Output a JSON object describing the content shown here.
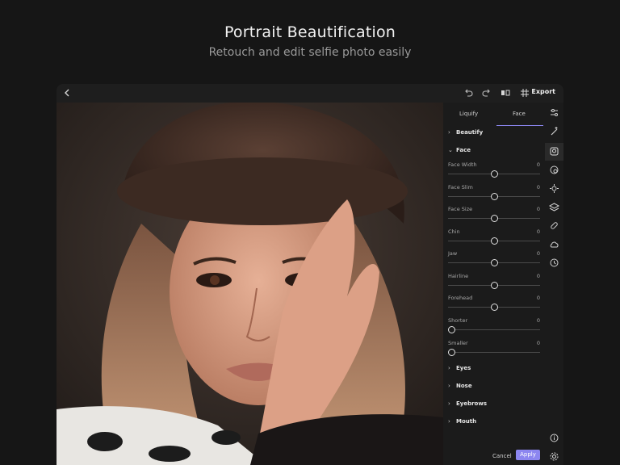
{
  "hero": {
    "title": "Portrait Beautification",
    "subtitle": "Retouch and edit selfie photo easily"
  },
  "toolbar": {
    "back_icon": "chevron-left-icon",
    "undo_icon": "undo-icon",
    "redo_icon": "redo-icon",
    "compare_icon": "compare-icon",
    "grid_icon": "grid-icon",
    "export_label": "Export"
  },
  "tabs": [
    {
      "label": "Liquify",
      "active": false
    },
    {
      "label": "Face",
      "active": true
    }
  ],
  "sections": {
    "beautify": "Beautify",
    "face": "Face",
    "eyes": "Eyes",
    "nose": "Nose",
    "eyebrows": "Eyebrows",
    "mouth": "Mouth"
  },
  "sliders": [
    {
      "label": "Face Width",
      "value": "0",
      "position": 0.5
    },
    {
      "label": "Face Slim",
      "value": "0",
      "position": 0.5
    },
    {
      "label": "Face Size",
      "value": "0",
      "position": 0.5
    },
    {
      "label": "Chin",
      "value": "0",
      "position": 0.5
    },
    {
      "label": "Jaw",
      "value": "0",
      "position": 0.5
    },
    {
      "label": "Hairline",
      "value": "0",
      "position": 0.5
    },
    {
      "label": "Forehead",
      "value": "0",
      "position": 0.5
    },
    {
      "label": "Shorter",
      "value": "0",
      "position": 0.0
    },
    {
      "label": "Smaller",
      "value": "0",
      "position": 0.0
    }
  ],
  "footer": {
    "cancel": "Cancel",
    "apply": "Apply"
  },
  "rail_icons": [
    "adjust-icon",
    "magic-icon",
    "face-icon",
    "retouch-icon",
    "effects-icon",
    "layers-icon",
    "heal-icon",
    "weather-icon",
    "history-icon",
    "info-icon",
    "settings-icon"
  ],
  "colors": {
    "accent": "#8c86f0",
    "background": "#161616",
    "panel": "#1b1b1b"
  }
}
